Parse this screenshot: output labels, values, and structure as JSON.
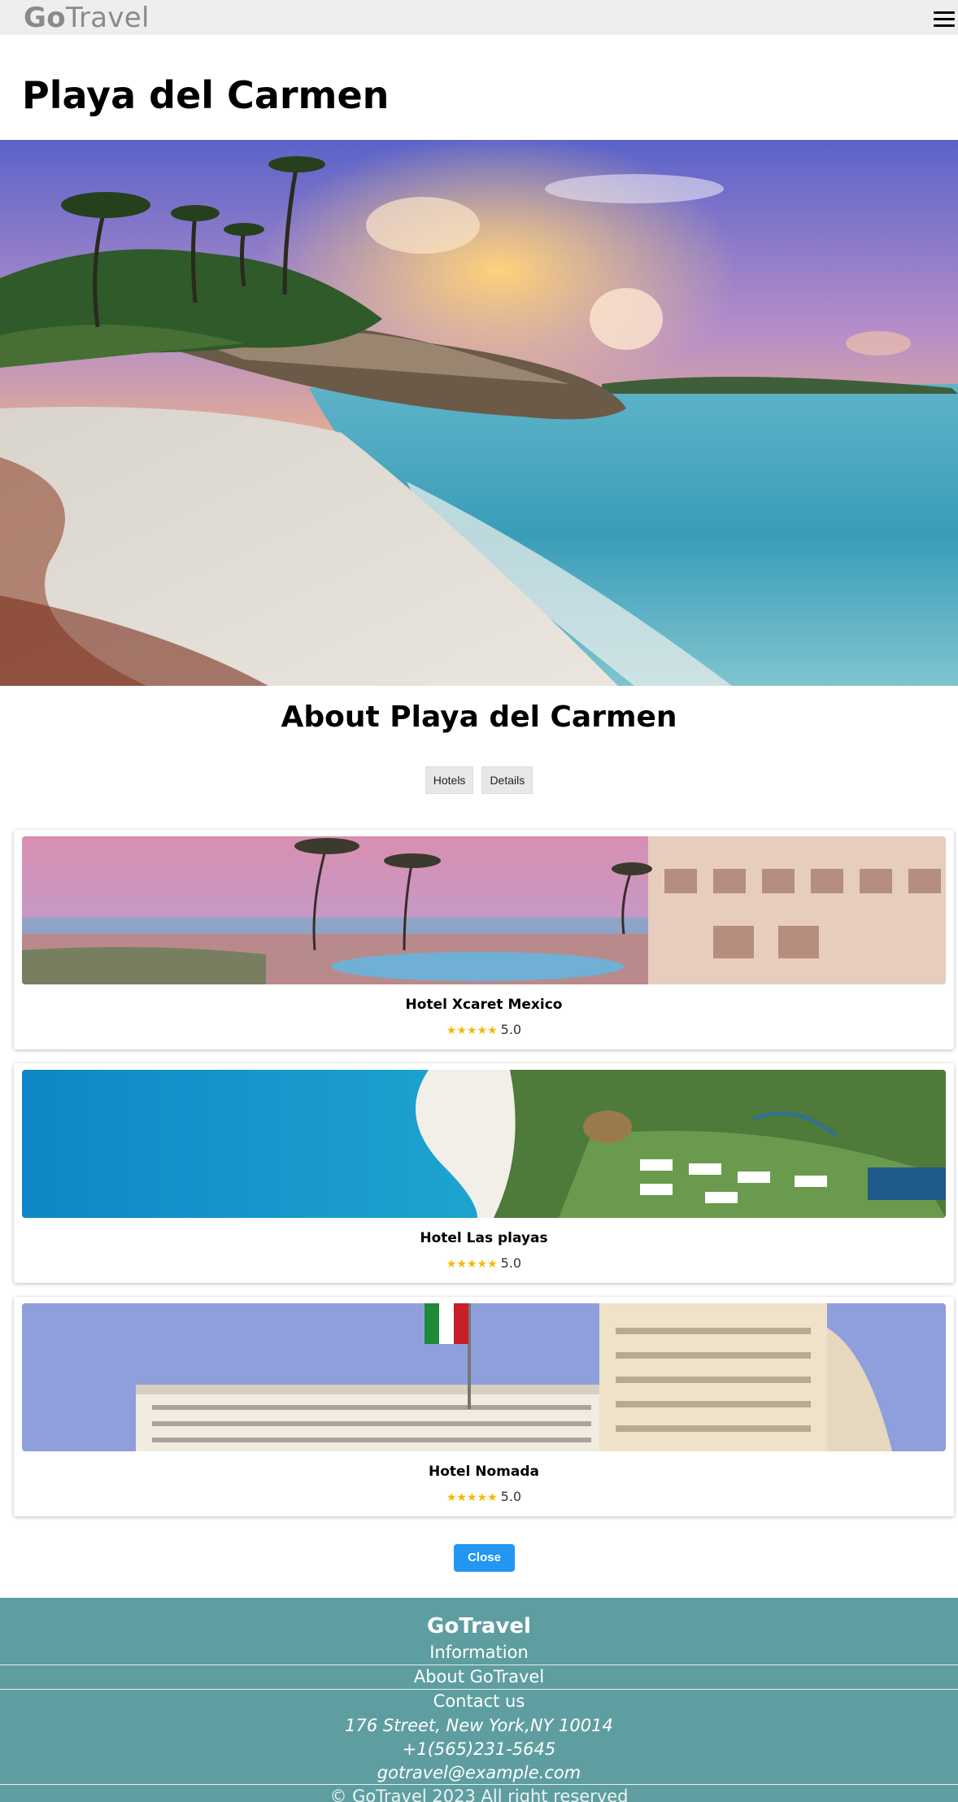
{
  "header": {
    "logo_bold": "Go",
    "logo_rest": "Travel"
  },
  "page": {
    "title": "Playa del Carmen",
    "about_title": "About Playa del Carmen"
  },
  "tabs": [
    {
      "label": "Hotels"
    },
    {
      "label": "Details"
    }
  ],
  "hotels": [
    {
      "name": "Hotel Xcaret Mexico",
      "stars": "★★★★★",
      "score": "5.0"
    },
    {
      "name": "Hotel Las playas",
      "stars": "★★★★★",
      "score": "5.0"
    },
    {
      "name": "Hotel Nomada",
      "stars": "★★★★★",
      "score": "5.0"
    }
  ],
  "actions": {
    "close_label": "Close"
  },
  "footer": {
    "brand": "GoTravel",
    "information": "Information",
    "about": "About GoTravel",
    "contact": "Contact us",
    "address": "176 Street, New York,NY 10014",
    "phone": "+1(565)231-5645",
    "email": "gotravel@example.com",
    "copyright": "© GoTravel 2023 All right reserved"
  },
  "colors": {
    "header_bg": "#eeeeee",
    "footer_bg": "#5f9ea0",
    "accent": "#2196f3",
    "star": "#f5b800"
  }
}
